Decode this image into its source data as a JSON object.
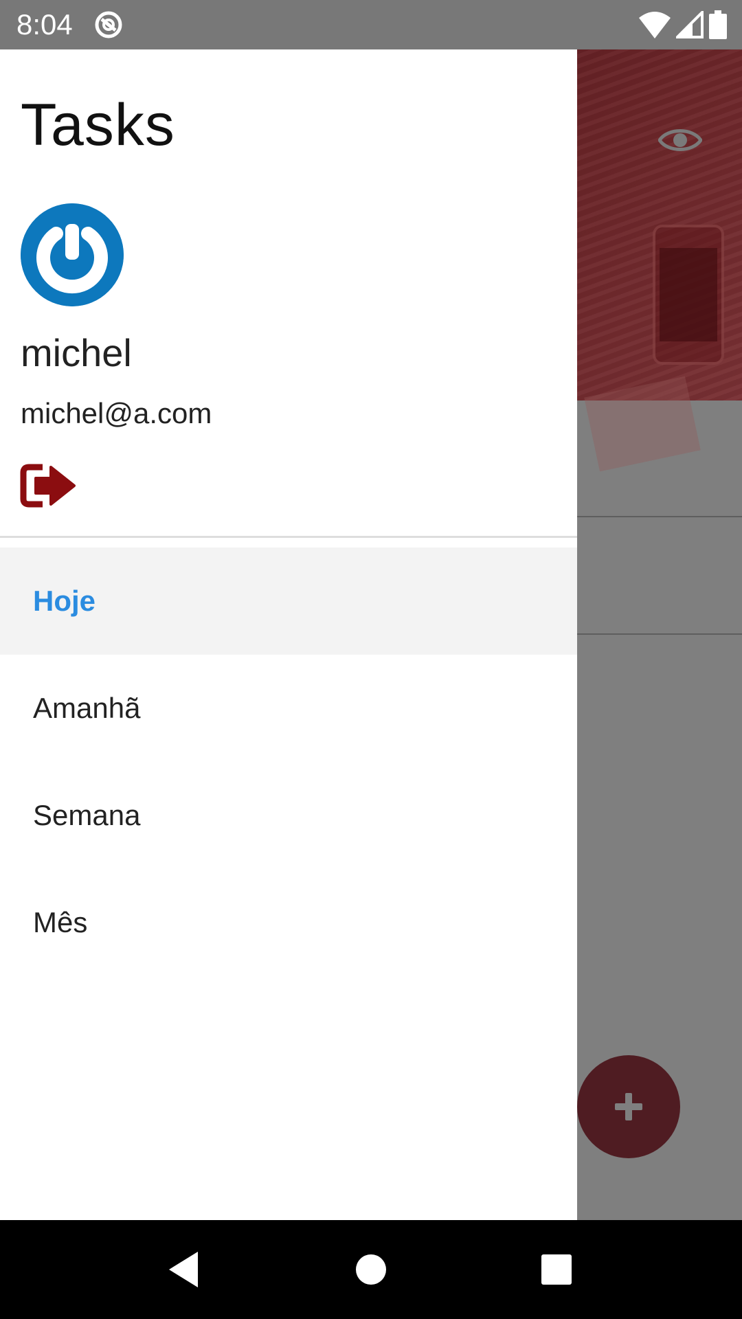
{
  "status_bar": {
    "time": "8:04",
    "icons": [
      "sync-icon",
      "wifi-icon",
      "signal-icon",
      "battery-icon"
    ]
  },
  "drawer": {
    "title": "Tasks",
    "user": {
      "name": "michel",
      "email": "michel@a.com",
      "avatar_icon": "power-icon"
    },
    "logout_icon": "sign-out-icon",
    "items": [
      {
        "label": "Hoje",
        "active": true
      },
      {
        "label": "Amanhã",
        "active": false
      },
      {
        "label": "Semana",
        "active": false
      },
      {
        "label": "Mês",
        "active": false
      }
    ]
  },
  "background_app": {
    "header_icon": "eye-icon",
    "fab_icon": "plus-icon"
  },
  "colors": {
    "accent_blue": "#2b8ce0",
    "brand_red": "#8b0d10",
    "avatar_blue": "#0d78bd",
    "fab_color": "#4f1c22",
    "scrim": "#7f7f7f"
  },
  "system_nav": {
    "icons": [
      "back-icon",
      "home-icon",
      "recents-icon"
    ]
  }
}
